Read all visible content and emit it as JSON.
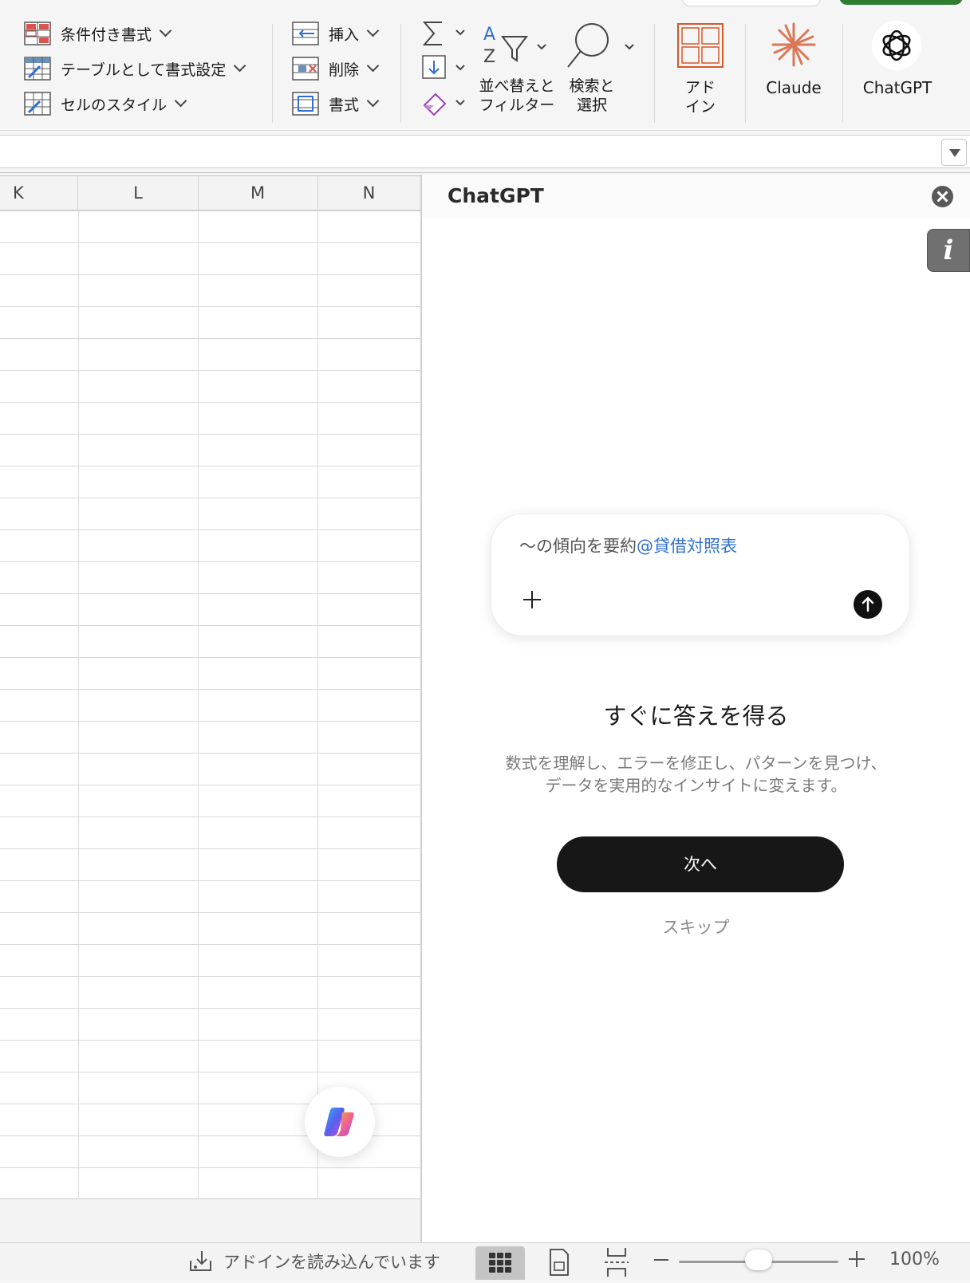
{
  "ribbon": {
    "styles": {
      "conditional_format": "条件付き書式",
      "format_as_table": "テーブルとして書式設定",
      "cell_styles": "セルのスタイル"
    },
    "cells": {
      "insert": "挿入",
      "delete": "削除",
      "format": "書式"
    },
    "editing": {
      "sort_filter_line1": "並べ替えと",
      "sort_filter_line2": "フィルター",
      "find_select_line1": "検索と",
      "find_select_line2": "選択"
    },
    "addins": {
      "addins_line1": "アド",
      "addins_line2": "イン",
      "claude": "Claude",
      "chatgpt": "ChatGPT"
    },
    "accent_color": "#2e7d32"
  },
  "grid": {
    "columns": [
      "K",
      "L",
      "M",
      "N"
    ]
  },
  "pane": {
    "title": "ChatGPT",
    "info_icon": "i",
    "prompt": {
      "text": "〜の傾向を要約",
      "mention": "@貸借対照表"
    },
    "headline": "すぐに答えを得る",
    "subtext_line1": "数式を理解し、エラーを修正し、パターンを見つけ、",
    "subtext_line2": "データを実用的なインサイトに変えます。",
    "next_label": "次へ",
    "skip_label": "スキップ"
  },
  "status_bar": {
    "status_text": "アドインを読み込んでいます",
    "zoom_level": "100%"
  }
}
